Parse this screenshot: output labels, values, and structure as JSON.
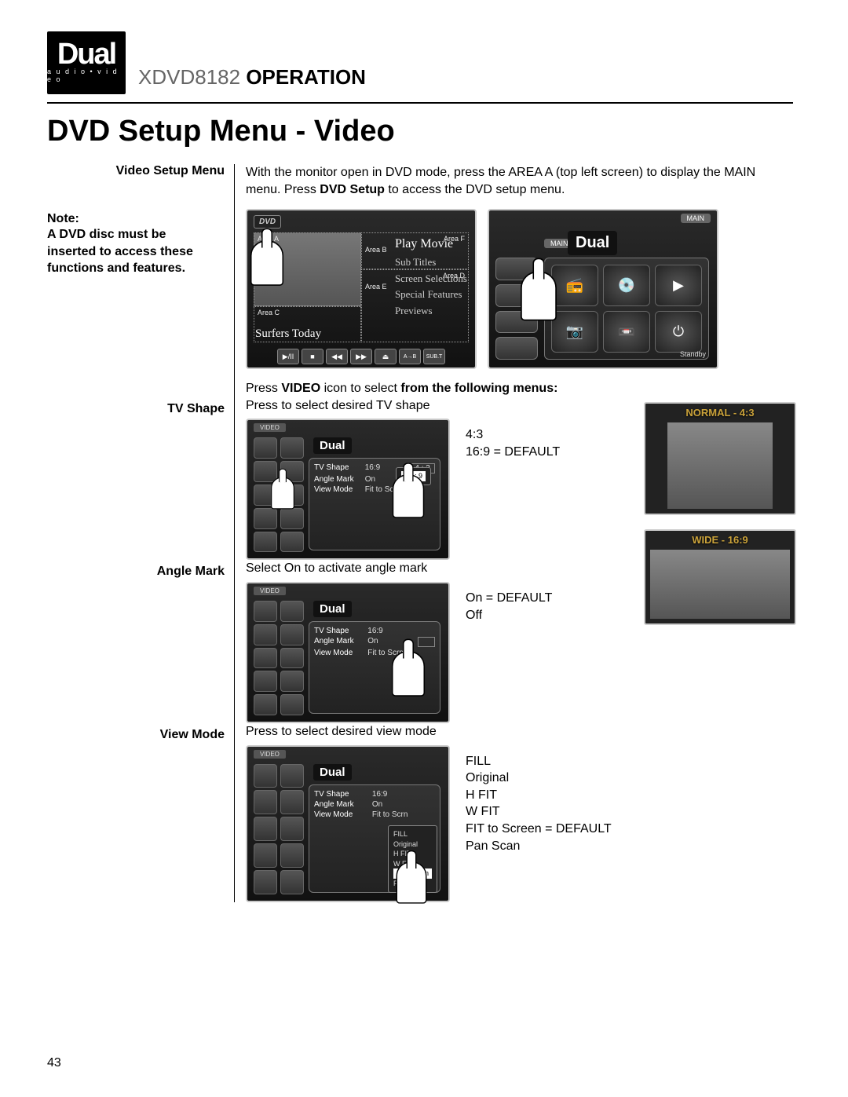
{
  "header": {
    "logo": "Dual",
    "logo_sub": "a u d i o • v i d e o",
    "model": "XDVD8182",
    "operation": "OPERATION"
  },
  "section_title": "DVD Setup Menu - Video",
  "intro": {
    "label": "Video Setup Menu",
    "text_prefix": "With the monitor open in DVD mode, press the AREA A (top left screen) to display the MAIN menu. Press ",
    "text_bold": "DVD Setup",
    "text_suffix": " to access the DVD setup menu."
  },
  "note": {
    "label": "Note:",
    "text": "A DVD disc must be inserted to access these functions and features."
  },
  "dvd_areas": {
    "a": "Area A",
    "b": "Area B",
    "c": "Area C",
    "d": "Area D",
    "e": "Area E",
    "f": "Area F"
  },
  "dvd_menu_items": [
    "Play Movie",
    "Sub Titles",
    "Screen Selections",
    "Special Features",
    "Previews"
  ],
  "dvd_footer_label": "Surfers Today",
  "dvd_controls": [
    "▶/II",
    "■",
    "◀◀",
    "▶▶",
    "⏏",
    "A→B",
    "SUB.T"
  ],
  "dvd_logo": "DVD",
  "main_screen": {
    "tag": "MAIN",
    "brand": "Dual",
    "standby": "Standby",
    "icons": [
      "📻",
      "💿",
      "▶",
      "📷",
      "📼",
      "⏻"
    ]
  },
  "video_prompt": {
    "pre": "Press ",
    "video": "VIDEO",
    "mid": " icon to select ",
    "tail": "from the following menus:"
  },
  "settings_common": {
    "tag": "VIDEO",
    "brand": "Dual",
    "rows": {
      "tvshape": {
        "k": "TV Shape",
        "v": "16:9",
        "opt": "4 : 3"
      },
      "anglemark": {
        "k": "Angle Mark",
        "v": "On"
      },
      "viewmode": {
        "k": "View Mode",
        "v": "Fit to Scrn"
      }
    },
    "tvshape_sel": "16 : 9"
  },
  "tvshape": {
    "label": "TV Shape",
    "desc": "Press to select desired TV shape",
    "opt1": "4:3",
    "opt2": "16:9 = DEFAULT"
  },
  "anglemark": {
    "label": "Angle Mark",
    "desc": "Select On to activate angle mark",
    "opt1": "On = DEFAULT",
    "opt2": "Off"
  },
  "viewmode": {
    "label": "View Mode",
    "desc": "Press to select desired view mode",
    "opts": [
      "FILL",
      "Original",
      "H FIT",
      "W FIT",
      "FIT to Screen = DEFAULT",
      "Pan Scan"
    ],
    "popup": [
      "FILL",
      "Original",
      "H FIT",
      "W FIT",
      "Fit to Scrn",
      "Pan Scan"
    ]
  },
  "ratio": {
    "normal": "NORMAL - 4:3",
    "wide": "WIDE - 16:9"
  },
  "page_number": "43"
}
